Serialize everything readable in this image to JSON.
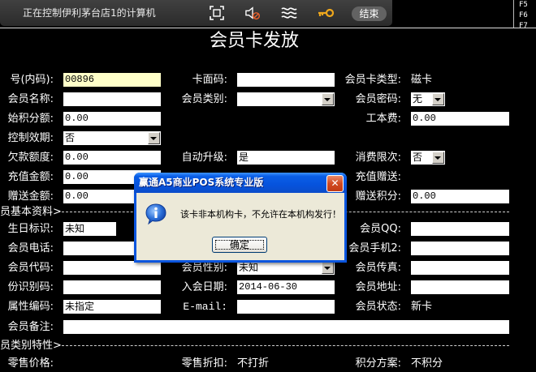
{
  "remote_toolbar": {
    "status_text": "正在控制伊利茅台店1的计算机",
    "icons": [
      "fullscreen-icon",
      "mute-speaker-icon",
      "waves-icon",
      "key-icon"
    ],
    "end_button": "结束"
  },
  "function_keys": [
    "F5",
    "F6",
    "F7"
  ],
  "window": {
    "title": "会员卡发放"
  },
  "fields": {
    "card_no": {
      "label": "号(内码):",
      "value": "00896"
    },
    "face_code": {
      "label": "卡面码:"
    },
    "card_type": {
      "label": "会员卡类型:",
      "value": "磁卡"
    },
    "member_name": {
      "label": "会员名称:"
    },
    "member_category": {
      "label": "会员类别:"
    },
    "member_password": {
      "label": "会员密码:",
      "value": "无"
    },
    "initial_points": {
      "label": "始积分额:",
      "value": "0.00"
    },
    "card_fee": {
      "label": "工本费:",
      "value": "0.00"
    },
    "control_expiry": {
      "label": "控制效期:",
      "value": "否"
    },
    "credit_limit": {
      "label": "欠款额度:",
      "value": "0.00"
    },
    "auto_upgrade": {
      "label": "自动升级:",
      "value": "是"
    },
    "consume_limit": {
      "label": "消费限次:",
      "value": "否"
    },
    "recharge_amount": {
      "label": "充值金额:",
      "value": "0.00"
    },
    "recharge_bonus": {
      "label": "充值赠送:"
    },
    "bonus_amount": {
      "label": "赠送金额:",
      "value": "0.00"
    },
    "bonus_points": {
      "label": "赠送积分:",
      "value": "0.00"
    },
    "birthday_flag": {
      "label": "生日标识:",
      "value": "未知"
    },
    "member_qq": {
      "label": "会员QQ:"
    },
    "member_phone": {
      "label": "会员电话:"
    },
    "member_mobile2": {
      "label": "会员手机2:"
    },
    "member_code": {
      "label": "会员代码:"
    },
    "member_gender": {
      "label": "会员性别:",
      "value": "未知"
    },
    "member_fax": {
      "label": "会员传真:"
    },
    "id_code": {
      "label": "份识别码:"
    },
    "join_date": {
      "label": "入会日期:",
      "value": "2014-06-30"
    },
    "member_address": {
      "label": "会员地址:"
    },
    "attribute_code": {
      "label": "属性编码:",
      "value": "未指定"
    },
    "email": {
      "label": "E-mail:"
    },
    "member_status": {
      "label": "会员状态:",
      "value": "新卡"
    },
    "member_remark": {
      "label": "会员备注:"
    },
    "retail_price": {
      "label": "零售价格:"
    },
    "retail_discount": {
      "label": "零售折扣:",
      "value": "不打折"
    },
    "points_scheme": {
      "label": "积分方案:",
      "value": "不积分"
    }
  },
  "sections": {
    "basic_info": "员基本资料>",
    "category_traits": "员类别特性>"
  },
  "dialog": {
    "title": "赢通A5商业POS系统专业版",
    "message": "该卡非本机构卡，不允许在本机构发行！",
    "ok_button": "确定",
    "icon": "info-icon"
  },
  "colors": {
    "background": "#000000",
    "label_text": "#ffffff",
    "field_background": "#ffffff",
    "focused_field": "#ffffc8",
    "dialog_title_bar": "#0a5ee6",
    "dialog_body": "#ece9d8",
    "close_button": "#d14a22"
  }
}
